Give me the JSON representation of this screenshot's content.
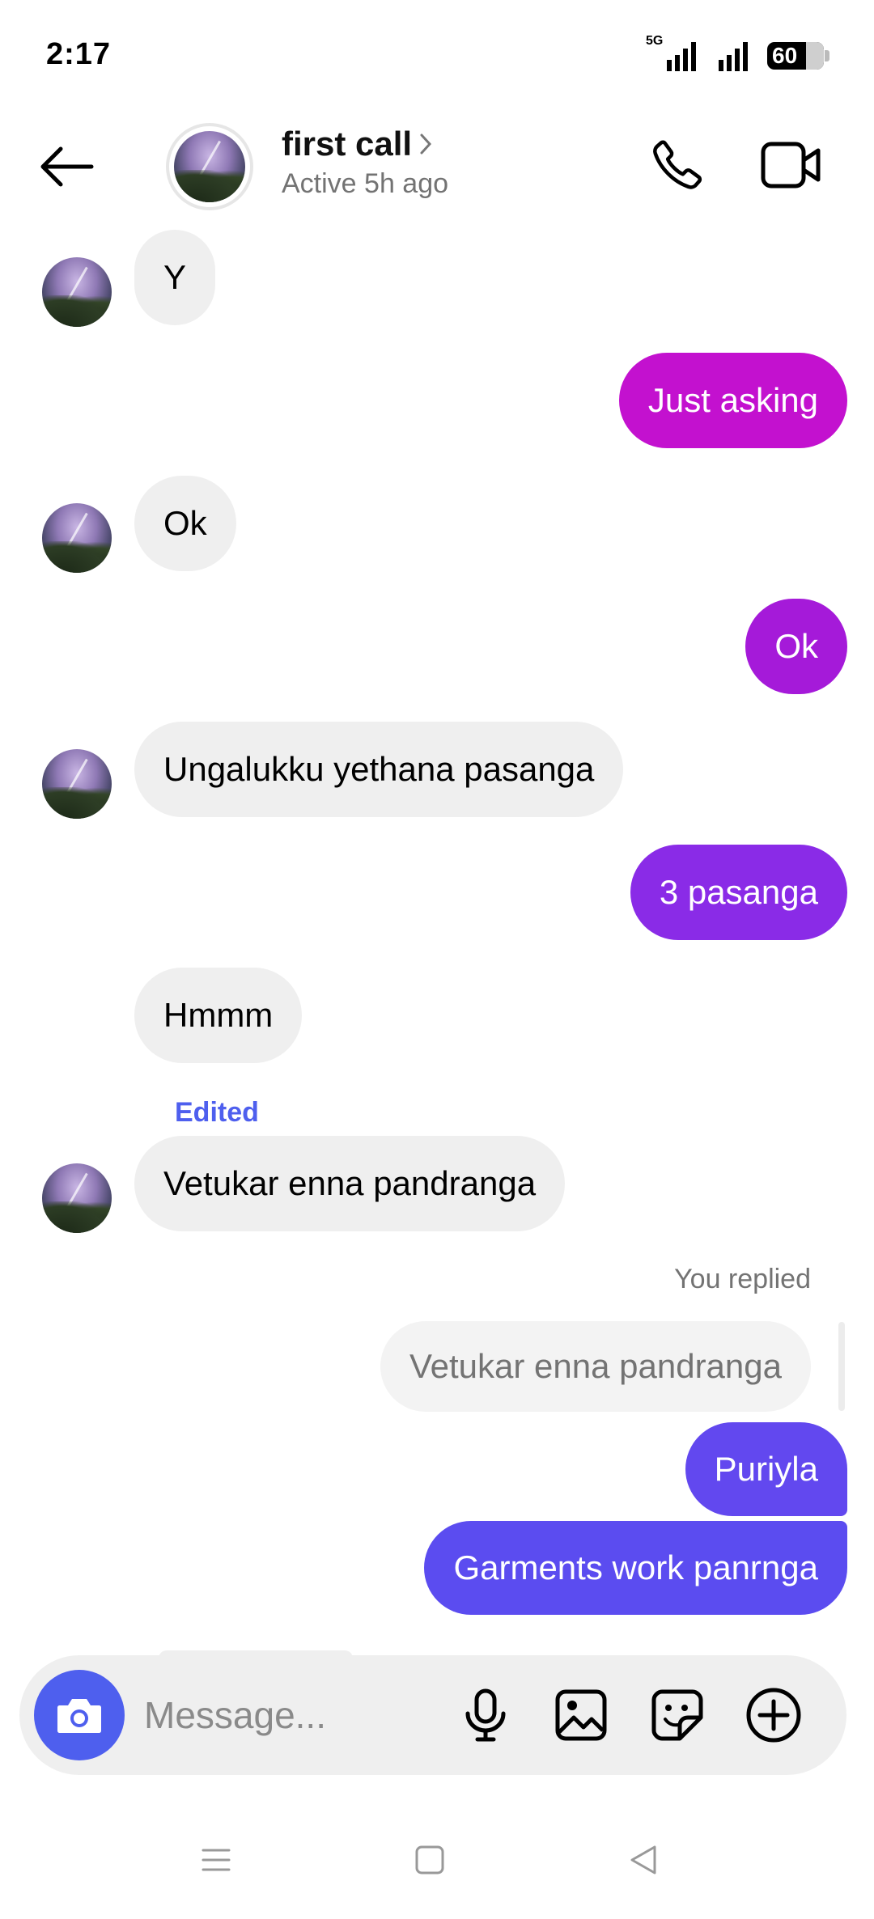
{
  "status_bar": {
    "time": "2:17",
    "network": "5G",
    "battery": "60"
  },
  "header": {
    "contact_name": "first call",
    "contact_status": "Active 5h ago"
  },
  "messages": [
    {
      "side": "in",
      "text": "Y"
    },
    {
      "side": "out",
      "text": "Just asking",
      "color": "#c311cf"
    },
    {
      "side": "in",
      "text": "Ok"
    },
    {
      "side": "out",
      "text": "Ok",
      "color": "#a51ad9"
    },
    {
      "side": "in",
      "text": "Ungalukku yethana pasanga"
    },
    {
      "side": "out",
      "text": "3 pasanga",
      "color": "#8a2be7"
    },
    {
      "side": "in",
      "text": "Hmmm"
    },
    {
      "side": "in",
      "text": "Vetukar enna pandranga",
      "edited_label": "Edited"
    },
    {
      "side": "out",
      "text": "Puriyla",
      "color": "#6248ef"
    },
    {
      "side": "out",
      "text": "Garments work panrnga",
      "color": "#5b4cf0"
    }
  ],
  "reply": {
    "label": "You replied",
    "quoted_text": "Vetukar enna pandranga"
  },
  "composer": {
    "placeholder": "Message..."
  },
  "colors": {
    "accent": "#4e5fee",
    "incoming_bubble": "#efefef"
  }
}
